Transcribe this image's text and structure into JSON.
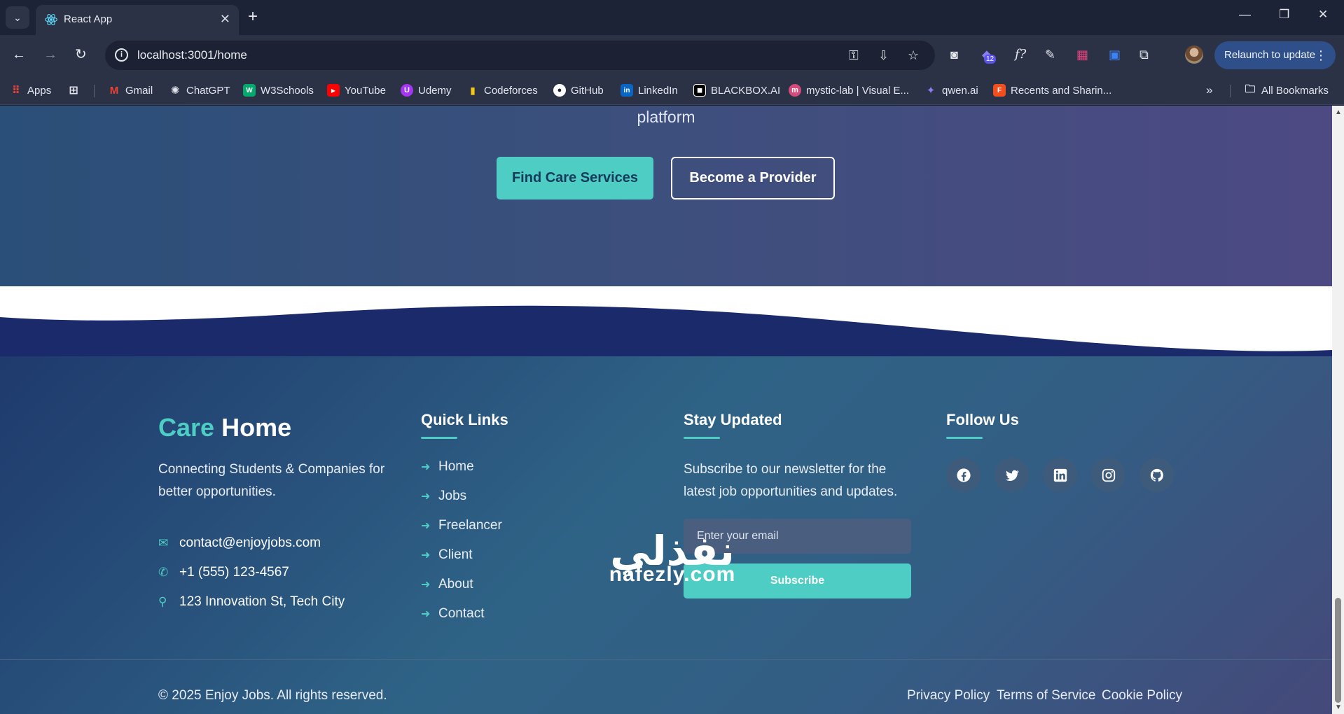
{
  "browser": {
    "tab_title": "React App",
    "url": "localhost:3001/home",
    "relaunch_label": "Relaunch to update",
    "extension_badge": "12",
    "bookmarks": [
      {
        "label": "Apps",
        "icon": "apps-grid-icon"
      },
      {
        "label": "Gmail",
        "icon": "gmail-icon"
      },
      {
        "label": "ChatGPT",
        "icon": "chatgpt-icon"
      },
      {
        "label": "W3Schools",
        "icon": "w3schools-icon"
      },
      {
        "label": "YouTube",
        "icon": "youtube-icon"
      },
      {
        "label": "Udemy",
        "icon": "udemy-icon"
      },
      {
        "label": "Codeforces",
        "icon": "codeforces-icon"
      },
      {
        "label": "GitHub",
        "icon": "github-icon"
      },
      {
        "label": "LinkedIn",
        "icon": "linkedin-icon"
      },
      {
        "label": "BLACKBOX.AI",
        "icon": "blackbox-icon"
      },
      {
        "label": "mystic-lab | Visual E...",
        "icon": "mystic-lab-icon"
      },
      {
        "label": "qwen.ai",
        "icon": "qwen-icon"
      },
      {
        "label": "Recents and Sharin...",
        "icon": "figma-icon"
      }
    ],
    "all_bookmarks_label": "All Bookmarks"
  },
  "hero": {
    "tail_text": "platform",
    "primary_cta": "Find Care Services",
    "secondary_cta": "Become a Provider"
  },
  "footer": {
    "brand_first": "Care",
    "brand_second": "Home",
    "tagline": "Connecting Students & Companies for better opportunities.",
    "contacts": [
      {
        "icon": "envelope-icon",
        "text": "contact@enjoyjobs.com"
      },
      {
        "icon": "phone-icon",
        "text": "+1 (555) 123-4567"
      },
      {
        "icon": "map-pin-icon",
        "text": "123 Innovation St, Tech City"
      }
    ],
    "quick_links_title": "Quick Links",
    "quick_links": [
      "Home",
      "Jobs",
      "Freelancer",
      "Client",
      "About",
      "Contact"
    ],
    "newsletter_title": "Stay Updated",
    "newsletter_text": "Subscribe to our newsletter for the latest job opportunities and updates.",
    "email_placeholder": "Enter your email",
    "subscribe_label": "Subscribe",
    "follow_title": "Follow Us",
    "socials": [
      "facebook-icon",
      "twitter-icon",
      "linkedin-icon",
      "instagram-icon",
      "github-icon"
    ],
    "copyright": "© 2025 Enjoy Jobs. All rights reserved.",
    "legal_links": [
      "Privacy Policy",
      "Terms of Service",
      "Cookie Policy"
    ]
  },
  "watermark": {
    "arabic": "نفذلي",
    "latin": "nafezly.com"
  },
  "colors": {
    "accent": "#4ecdc4",
    "footer_bg": "#2f6386",
    "chrome_bg": "#2b3246"
  }
}
